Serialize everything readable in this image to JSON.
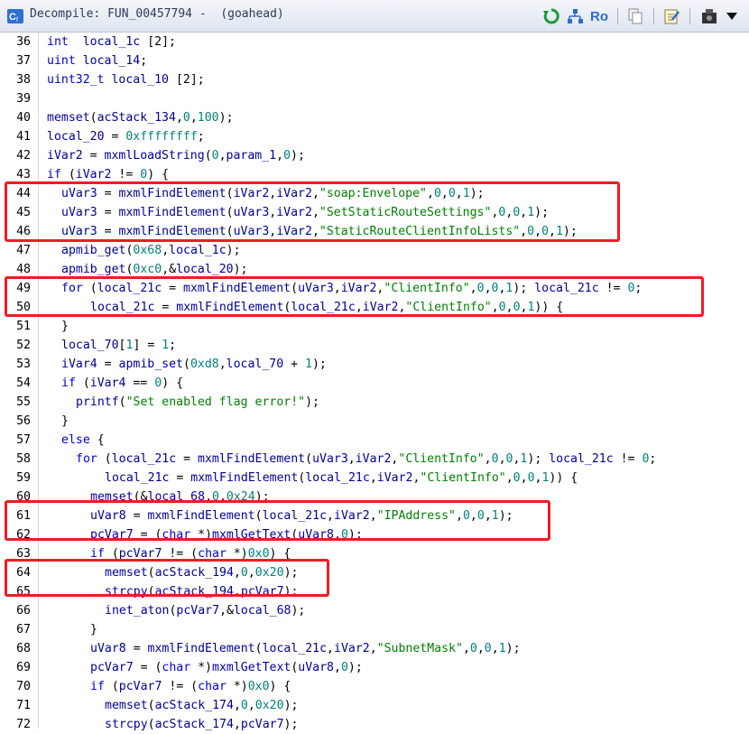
{
  "window": {
    "title": "Decompile: FUN_00457794 -  (goahead)",
    "icons": [
      "decompiler-icon",
      "refresh-icon",
      "graph-icon",
      "rename-icon",
      "copy-icon",
      "edit-icon",
      "snapshot-icon",
      "menu-dropdown-icon"
    ],
    "rename_label": "Ro"
  },
  "colors": {
    "keyword": "#0000d0",
    "string": "#008000",
    "number": "#008080",
    "highlight": "#ee1c24"
  },
  "code_lines": [
    {
      "n": "36",
      "indent": 0,
      "tokens": [
        [
          "k",
          "int"
        ],
        [
          "",
          "  "
        ],
        [
          "v",
          "local_1c"
        ],
        [
          "",
          " [2];"
        ]
      ]
    },
    {
      "n": "37",
      "indent": 0,
      "tokens": [
        [
          "k",
          "uint"
        ],
        [
          "",
          " "
        ],
        [
          "v",
          "local_14"
        ],
        [
          "",
          ";"
        ]
      ]
    },
    {
      "n": "38",
      "indent": 0,
      "tokens": [
        [
          "k",
          "uint32_t"
        ],
        [
          "",
          " "
        ],
        [
          "v",
          "local_10"
        ],
        [
          "",
          " [2];"
        ]
      ]
    },
    {
      "n": "39",
      "indent": 0,
      "tokens": []
    },
    {
      "n": "40",
      "indent": 0,
      "tokens": [
        [
          "f",
          "memset"
        ],
        [
          "",
          "("
        ],
        [
          "v",
          "acStack_134"
        ],
        [
          "",
          ","
        ],
        [
          "n",
          "0"
        ],
        [
          "",
          ","
        ],
        [
          "n",
          "100"
        ],
        [
          "",
          ");"
        ]
      ]
    },
    {
      "n": "41",
      "indent": 0,
      "tokens": [
        [
          "v",
          "local_20"
        ],
        [
          "",
          " = "
        ],
        [
          "n",
          "0xffffffff"
        ],
        [
          "",
          ";"
        ]
      ]
    },
    {
      "n": "42",
      "indent": 0,
      "tokens": [
        [
          "v",
          "iVar2"
        ],
        [
          "",
          " = "
        ],
        [
          "f",
          "mxmlLoadString"
        ],
        [
          "",
          "("
        ],
        [
          "n",
          "0"
        ],
        [
          "",
          ","
        ],
        [
          "v",
          "param_1"
        ],
        [
          "",
          ","
        ],
        [
          "n",
          "0"
        ],
        [
          "",
          ");"
        ]
      ]
    },
    {
      "n": "43",
      "indent": 0,
      "tokens": [
        [
          "k",
          "if"
        ],
        [
          "",
          " ("
        ],
        [
          "v",
          "iVar2"
        ],
        [
          "",
          " != "
        ],
        [
          "n",
          "0"
        ],
        [
          "",
          ") {"
        ]
      ]
    },
    {
      "n": "44",
      "indent": 1,
      "tokens": [
        [
          "v",
          "uVar3"
        ],
        [
          "",
          " = "
        ],
        [
          "f",
          "mxmlFindElement"
        ],
        [
          "",
          "("
        ],
        [
          "v",
          "iVar2"
        ],
        [
          "",
          ","
        ],
        [
          "v",
          "iVar2"
        ],
        [
          "",
          ","
        ],
        [
          "s",
          "\"soap:Envelope\""
        ],
        [
          "",
          ","
        ],
        [
          "n",
          "0"
        ],
        [
          "",
          ","
        ],
        [
          "n",
          "0"
        ],
        [
          "",
          ","
        ],
        [
          "n",
          "1"
        ],
        [
          "",
          ");"
        ]
      ]
    },
    {
      "n": "45",
      "indent": 1,
      "tokens": [
        [
          "v",
          "uVar3"
        ],
        [
          "",
          " = "
        ],
        [
          "f",
          "mxmlFindElement"
        ],
        [
          "",
          "("
        ],
        [
          "v",
          "uVar3"
        ],
        [
          "",
          ","
        ],
        [
          "v",
          "iVar2"
        ],
        [
          "",
          ","
        ],
        [
          "s",
          "\"SetStaticRouteSettings\""
        ],
        [
          "",
          ","
        ],
        [
          "n",
          "0"
        ],
        [
          "",
          ","
        ],
        [
          "n",
          "0"
        ],
        [
          "",
          ","
        ],
        [
          "n",
          "1"
        ],
        [
          "",
          ");"
        ]
      ]
    },
    {
      "n": "46",
      "indent": 1,
      "tokens": [
        [
          "v",
          "uVar3"
        ],
        [
          "",
          " = "
        ],
        [
          "f",
          "mxmlFindElement"
        ],
        [
          "",
          "("
        ],
        [
          "v",
          "uVar3"
        ],
        [
          "",
          ","
        ],
        [
          "v",
          "iVar2"
        ],
        [
          "",
          ","
        ],
        [
          "s",
          "\"StaticRouteClientInfoLists\""
        ],
        [
          "",
          ","
        ],
        [
          "n",
          "0"
        ],
        [
          "",
          ","
        ],
        [
          "n",
          "0"
        ],
        [
          "",
          ","
        ],
        [
          "n",
          "1"
        ],
        [
          "",
          ");"
        ]
      ]
    },
    {
      "n": "47",
      "indent": 1,
      "tokens": [
        [
          "f",
          "apmib_get"
        ],
        [
          "",
          "("
        ],
        [
          "n",
          "0x68"
        ],
        [
          "",
          ","
        ],
        [
          "v",
          "local_1c"
        ],
        [
          "",
          ");"
        ]
      ]
    },
    {
      "n": "48",
      "indent": 1,
      "tokens": [
        [
          "f",
          "apmib_get"
        ],
        [
          "",
          "("
        ],
        [
          "n",
          "0xc0"
        ],
        [
          "",
          ",&"
        ],
        [
          "v",
          "local_20"
        ],
        [
          "",
          ");"
        ]
      ]
    },
    {
      "n": "49",
      "indent": 1,
      "tokens": [
        [
          "k",
          "for"
        ],
        [
          "",
          " ("
        ],
        [
          "v",
          "local_21c"
        ],
        [
          "",
          " = "
        ],
        [
          "f",
          "mxmlFindElement"
        ],
        [
          "",
          "("
        ],
        [
          "v",
          "uVar3"
        ],
        [
          "",
          ","
        ],
        [
          "v",
          "iVar2"
        ],
        [
          "",
          ","
        ],
        [
          "s",
          "\"ClientInfo\""
        ],
        [
          "",
          ","
        ],
        [
          "n",
          "0"
        ],
        [
          "",
          ","
        ],
        [
          "n",
          "0"
        ],
        [
          "",
          ","
        ],
        [
          "n",
          "1"
        ],
        [
          "",
          "); "
        ],
        [
          "v",
          "local_21c"
        ],
        [
          "",
          " != "
        ],
        [
          "n",
          "0"
        ],
        [
          "",
          ";"
        ]
      ]
    },
    {
      "n": "50",
      "indent": 3,
      "tokens": [
        [
          "v",
          "local_21c"
        ],
        [
          "",
          " = "
        ],
        [
          "f",
          "mxmlFindElement"
        ],
        [
          "",
          "("
        ],
        [
          "v",
          "local_21c"
        ],
        [
          "",
          ","
        ],
        [
          "v",
          "iVar2"
        ],
        [
          "",
          ","
        ],
        [
          "s",
          "\"ClientInfo\""
        ],
        [
          "",
          ","
        ],
        [
          "n",
          "0"
        ],
        [
          "",
          ","
        ],
        [
          "n",
          "0"
        ],
        [
          "",
          ","
        ],
        [
          "n",
          "1"
        ],
        [
          "",
          "))"
        ],
        [
          "",
          " {"
        ]
      ]
    },
    {
      "n": "51",
      "indent": 1,
      "tokens": [
        [
          "",
          "}"
        ]
      ]
    },
    {
      "n": "52",
      "indent": 1,
      "tokens": [
        [
          "v",
          "local_70"
        ],
        [
          "",
          "["
        ],
        [
          "n",
          "1"
        ],
        [
          "",
          "] = "
        ],
        [
          "n",
          "1"
        ],
        [
          "",
          ";"
        ]
      ]
    },
    {
      "n": "53",
      "indent": 1,
      "tokens": [
        [
          "v",
          "iVar4"
        ],
        [
          "",
          " = "
        ],
        [
          "f",
          "apmib_set"
        ],
        [
          "",
          "("
        ],
        [
          "n",
          "0xd8"
        ],
        [
          "",
          ","
        ],
        [
          "v",
          "local_70"
        ],
        [
          "",
          " + "
        ],
        [
          "n",
          "1"
        ],
        [
          "",
          ");"
        ]
      ]
    },
    {
      "n": "54",
      "indent": 1,
      "tokens": [
        [
          "k",
          "if"
        ],
        [
          "",
          " ("
        ],
        [
          "v",
          "iVar4"
        ],
        [
          "",
          " == "
        ],
        [
          "n",
          "0"
        ],
        [
          "",
          ") {"
        ]
      ]
    },
    {
      "n": "55",
      "indent": 2,
      "tokens": [
        [
          "f",
          "printf"
        ],
        [
          "",
          "("
        ],
        [
          "s",
          "\"Set enabled flag error!\""
        ],
        [
          "",
          ");"
        ]
      ]
    },
    {
      "n": "56",
      "indent": 1,
      "tokens": [
        [
          "",
          "}"
        ]
      ]
    },
    {
      "n": "57",
      "indent": 1,
      "tokens": [
        [
          "k",
          "else"
        ],
        [
          "",
          " {"
        ]
      ]
    },
    {
      "n": "58",
      "indent": 2,
      "tokens": [
        [
          "k",
          "for"
        ],
        [
          "",
          " ("
        ],
        [
          "v",
          "local_21c"
        ],
        [
          "",
          " = "
        ],
        [
          "f",
          "mxmlFindElement"
        ],
        [
          "",
          "("
        ],
        [
          "v",
          "uVar3"
        ],
        [
          "",
          ","
        ],
        [
          "v",
          "iVar2"
        ],
        [
          "",
          ","
        ],
        [
          "s",
          "\"ClientInfo\""
        ],
        [
          "",
          ","
        ],
        [
          "n",
          "0"
        ],
        [
          "",
          ","
        ],
        [
          "n",
          "0"
        ],
        [
          "",
          ","
        ],
        [
          "n",
          "1"
        ],
        [
          "",
          "); "
        ],
        [
          "v",
          "local_21c"
        ],
        [
          "",
          " != "
        ],
        [
          "n",
          "0"
        ],
        [
          "",
          ";"
        ]
      ]
    },
    {
      "n": "59",
      "indent": 4,
      "tokens": [
        [
          "v",
          "local_21c"
        ],
        [
          "",
          " = "
        ],
        [
          "f",
          "mxmlFindElement"
        ],
        [
          "",
          "("
        ],
        [
          "v",
          "local_21c"
        ],
        [
          "",
          ","
        ],
        [
          "v",
          "iVar2"
        ],
        [
          "",
          ","
        ],
        [
          "s",
          "\"ClientInfo\""
        ],
        [
          "",
          ","
        ],
        [
          "n",
          "0"
        ],
        [
          "",
          ","
        ],
        [
          "n",
          "0"
        ],
        [
          "",
          ","
        ],
        [
          "n",
          "1"
        ],
        [
          "",
          "))"
        ],
        [
          "",
          " {"
        ]
      ]
    },
    {
      "n": "60",
      "indent": 3,
      "tokens": [
        [
          "f",
          "memset"
        ],
        [
          "",
          "(&"
        ],
        [
          "v",
          "local_68"
        ],
        [
          "",
          ","
        ],
        [
          "n",
          "0"
        ],
        [
          "",
          ","
        ],
        [
          "n",
          "0x24"
        ],
        [
          "",
          ");"
        ]
      ]
    },
    {
      "n": "61",
      "indent": 3,
      "tokens": [
        [
          "v",
          "uVar8"
        ],
        [
          "",
          " = "
        ],
        [
          "f",
          "mxmlFindElement"
        ],
        [
          "",
          "("
        ],
        [
          "v",
          "local_21c"
        ],
        [
          "",
          ","
        ],
        [
          "v",
          "iVar2"
        ],
        [
          "",
          ","
        ],
        [
          "s",
          "\"IPAddress\""
        ],
        [
          "",
          ","
        ],
        [
          "n",
          "0"
        ],
        [
          "",
          ","
        ],
        [
          "n",
          "0"
        ],
        [
          "",
          ","
        ],
        [
          "n",
          "1"
        ],
        [
          "",
          ");"
        ]
      ]
    },
    {
      "n": "62",
      "indent": 3,
      "tokens": [
        [
          "v",
          "pcVar7"
        ],
        [
          "",
          " = ("
        ],
        [
          "k",
          "char"
        ],
        [
          "",
          " *)"
        ],
        [
          "f",
          "mxmlGetText"
        ],
        [
          "",
          "("
        ],
        [
          "v",
          "uVar8"
        ],
        [
          "",
          ","
        ],
        [
          "n",
          "0"
        ],
        [
          "",
          ");"
        ]
      ]
    },
    {
      "n": "63",
      "indent": 3,
      "tokens": [
        [
          "k",
          "if"
        ],
        [
          "",
          " ("
        ],
        [
          "v",
          "pcVar7"
        ],
        [
          "",
          " != ("
        ],
        [
          "k",
          "char"
        ],
        [
          "",
          " *)"
        ],
        [
          "n",
          "0x0"
        ],
        [
          "",
          ") {"
        ]
      ]
    },
    {
      "n": "64",
      "indent": 4,
      "tokens": [
        [
          "f",
          "memset"
        ],
        [
          "",
          "("
        ],
        [
          "v",
          "acStack_194"
        ],
        [
          "",
          ","
        ],
        [
          "n",
          "0"
        ],
        [
          "",
          ","
        ],
        [
          "n",
          "0x20"
        ],
        [
          "",
          ");"
        ]
      ]
    },
    {
      "n": "65",
      "indent": 4,
      "tokens": [
        [
          "f",
          "strcpy"
        ],
        [
          "",
          "("
        ],
        [
          "v",
          "acStack_194"
        ],
        [
          "",
          ","
        ],
        [
          "v",
          "pcVar7"
        ],
        [
          "",
          ");"
        ]
      ]
    },
    {
      "n": "66",
      "indent": 4,
      "tokens": [
        [
          "f",
          "inet_aton"
        ],
        [
          "",
          "("
        ],
        [
          "v",
          "pcVar7"
        ],
        [
          "",
          ",&"
        ],
        [
          "v",
          "local_68"
        ],
        [
          "",
          ");"
        ]
      ]
    },
    {
      "n": "67",
      "indent": 3,
      "tokens": [
        [
          "",
          "}"
        ]
      ]
    },
    {
      "n": "68",
      "indent": 3,
      "tokens": [
        [
          "v",
          "uVar8"
        ],
        [
          "",
          " = "
        ],
        [
          "f",
          "mxmlFindElement"
        ],
        [
          "",
          "("
        ],
        [
          "v",
          "local_21c"
        ],
        [
          "",
          ","
        ],
        [
          "v",
          "iVar2"
        ],
        [
          "",
          ","
        ],
        [
          "s",
          "\"SubnetMask\""
        ],
        [
          "",
          ","
        ],
        [
          "n",
          "0"
        ],
        [
          "",
          ","
        ],
        [
          "n",
          "0"
        ],
        [
          "",
          ","
        ],
        [
          "n",
          "1"
        ],
        [
          "",
          ");"
        ]
      ]
    },
    {
      "n": "69",
      "indent": 3,
      "tokens": [
        [
          "v",
          "pcVar7"
        ],
        [
          "",
          " = ("
        ],
        [
          "k",
          "char"
        ],
        [
          "",
          " *)"
        ],
        [
          "f",
          "mxmlGetText"
        ],
        [
          "",
          "("
        ],
        [
          "v",
          "uVar8"
        ],
        [
          "",
          ","
        ],
        [
          "n",
          "0"
        ],
        [
          "",
          ");"
        ]
      ]
    },
    {
      "n": "70",
      "indent": 3,
      "tokens": [
        [
          "k",
          "if"
        ],
        [
          "",
          " ("
        ],
        [
          "v",
          "pcVar7"
        ],
        [
          "",
          " != ("
        ],
        [
          "k",
          "char"
        ],
        [
          "",
          " *)"
        ],
        [
          "n",
          "0x0"
        ],
        [
          "",
          ") {"
        ]
      ]
    },
    {
      "n": "71",
      "indent": 4,
      "tokens": [
        [
          "f",
          "memset"
        ],
        [
          "",
          "("
        ],
        [
          "v",
          "acStack_174"
        ],
        [
          "",
          ","
        ],
        [
          "n",
          "0"
        ],
        [
          "",
          ","
        ],
        [
          "n",
          "0x20"
        ],
        [
          "",
          ");"
        ]
      ]
    },
    {
      "n": "72",
      "indent": 4,
      "tokens": [
        [
          "f",
          "strcpy"
        ],
        [
          "",
          "("
        ],
        [
          "v",
          "acStack_174"
        ],
        [
          "",
          ","
        ],
        [
          "v",
          "pcVar7"
        ],
        [
          "",
          ");"
        ]
      ]
    }
  ]
}
